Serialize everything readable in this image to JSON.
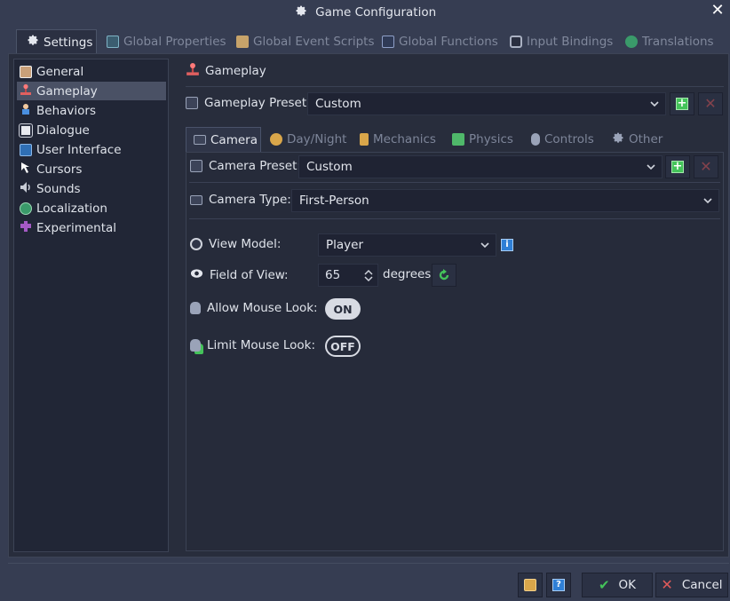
{
  "window": {
    "title": "Game Configuration"
  },
  "top_tabs": [
    {
      "label": "Settings",
      "active": true
    },
    {
      "label": "Global Properties",
      "active": false
    },
    {
      "label": "Global Event Scripts",
      "active": false
    },
    {
      "label": "Global Functions",
      "active": false
    },
    {
      "label": "Input Bindings",
      "active": false
    },
    {
      "label": "Translations",
      "active": false
    }
  ],
  "sidebar": {
    "items": [
      {
        "label": "General",
        "icon": "general-icon"
      },
      {
        "label": "Gameplay",
        "icon": "joystick-icon",
        "selected": true
      },
      {
        "label": "Behaviors",
        "icon": "behaviors-icon"
      },
      {
        "label": "Dialogue",
        "icon": "dialogue-icon"
      },
      {
        "label": "User Interface",
        "icon": "user-interface-icon"
      },
      {
        "label": "Cursors",
        "icon": "cursor-icon"
      },
      {
        "label": "Sounds",
        "icon": "sound-icon"
      },
      {
        "label": "Localization",
        "icon": "globe-icon"
      },
      {
        "label": "Experimental",
        "icon": "experimental-icon"
      }
    ]
  },
  "section": {
    "title": "Gameplay"
  },
  "gameplay_preset": {
    "label": "Gameplay Preset:",
    "value": "Custom"
  },
  "inner_tabs": [
    {
      "label": "Camera",
      "active": true
    },
    {
      "label": "Day/Night",
      "active": false
    },
    {
      "label": "Mechanics",
      "active": false
    },
    {
      "label": "Physics",
      "active": false
    },
    {
      "label": "Controls",
      "active": false
    },
    {
      "label": "Other",
      "active": false
    }
  ],
  "camera_preset": {
    "label": "Camera Preset:",
    "value": "Custom"
  },
  "camera_type": {
    "label": "Camera Type:",
    "value": "First-Person"
  },
  "view_model": {
    "label": "View Model:",
    "value": "Player"
  },
  "field_of_view": {
    "label": "Field of View:",
    "value": "65",
    "unit": "degrees"
  },
  "allow_mouse_look": {
    "label": "Allow Mouse Look:",
    "state": "ON"
  },
  "limit_mouse_look": {
    "label": "Limit Mouse Look:",
    "state": "OFF"
  },
  "footer": {
    "ok_label": "OK",
    "cancel_label": "Cancel"
  },
  "colors": {
    "background": "#363d52",
    "panel": "#282d3c",
    "accent_green": "#44c35a",
    "accent_red": "#e05a5a",
    "info_blue": "#2f7fd6"
  }
}
